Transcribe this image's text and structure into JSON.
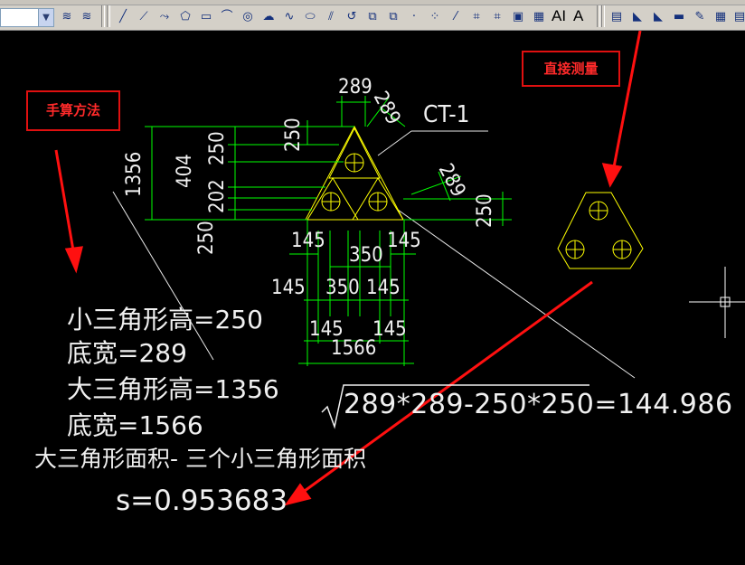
{
  "toolbar": {
    "layer_dropdown_value": "",
    "icons": [
      "layer-manager-icon",
      "layer-states-icon",
      "line-icon",
      "construction-line-icon",
      "polyline-icon",
      "polygon-icon",
      "rectangle-icon",
      "arc-icon",
      "circle-icon",
      "cloud-icon",
      "spline-icon",
      "ellipse-icon",
      "ellipse-arc-icon",
      "insert-block-icon",
      "make-block-icon",
      "point-icon",
      "hatch-icon",
      "gradient-icon",
      "region-icon",
      "table-icon",
      "dim-linear-icon",
      "dim-aligned-icon",
      "dim-baseline-icon",
      "dim-continue-icon",
      "dim-style-icon",
      "properties-icon",
      "match-properties-icon"
    ],
    "multiline_text_label": "AI",
    "text_label": "A"
  },
  "callouts": {
    "hand_calc": "手算方法",
    "direct_measure": "直接测量"
  },
  "dimensions": {
    "top_289": "289",
    "top_289_diag": "289",
    "ct_label": "CT-1",
    "left_250_a": "250",
    "left_250_b": "250",
    "left_202": "202",
    "left_250_c": "250",
    "left_404": "404",
    "left_1356": "1356",
    "right_289_diag": "289",
    "right_250": "250",
    "mid_145_left": "145",
    "mid_145_right": "145",
    "mid_350_top": "350",
    "mid_145_a": "145",
    "mid_350_b": "350",
    "mid_145_b": "145",
    "bot_145_left": "145",
    "bot_145_right": "145",
    "bot_1566": "1566"
  },
  "calc": {
    "line1": "小三角形高=250",
    "line2": "底宽=289",
    "line3": "大三角形高=1356",
    "line4": "底宽=1566",
    "line5": "大三角形面积- 三个小三角形面积",
    "formula": "289*289-250*250=144.986",
    "result": "s=0.953683"
  },
  "colors": {
    "background": "#000000",
    "dimension_green": "#00ff00",
    "geometry_yellow": "#ffff00",
    "callout_red": "#ff0000",
    "text_white": "#f0f0f0"
  }
}
